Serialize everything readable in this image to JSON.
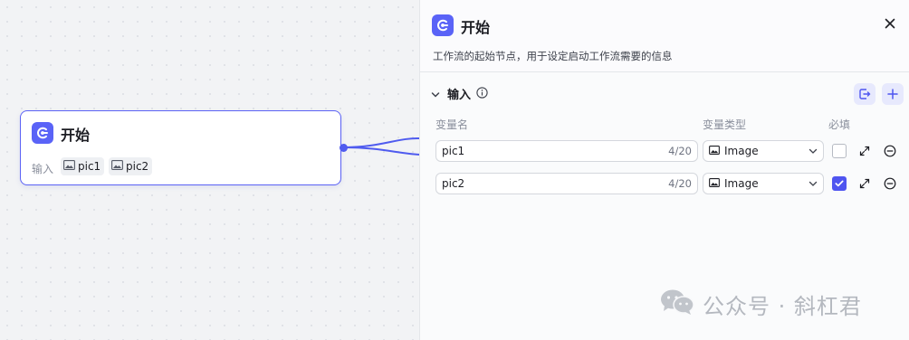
{
  "canvas_node": {
    "title": "开始",
    "input_label": "输入",
    "chips": [
      "pic1",
      "pic2"
    ]
  },
  "panel": {
    "title": "开始",
    "description": "工作流的起始节点，用于设定启动工作流需要的信息",
    "section_title": "输入",
    "columns": {
      "name": "变量名",
      "type": "变量类型",
      "required": "必填"
    },
    "rows": [
      {
        "name": "pic1",
        "count": "4/20",
        "type": "Image",
        "required": false
      },
      {
        "name": "pic2",
        "count": "4/20",
        "type": "Image",
        "required": true
      }
    ]
  },
  "watermark": {
    "text": "公众号 · 斜杠君",
    "icon": "wechat-icon"
  },
  "colors": {
    "accent": "#4f55f0",
    "brand_logo": "#5a63f7"
  }
}
